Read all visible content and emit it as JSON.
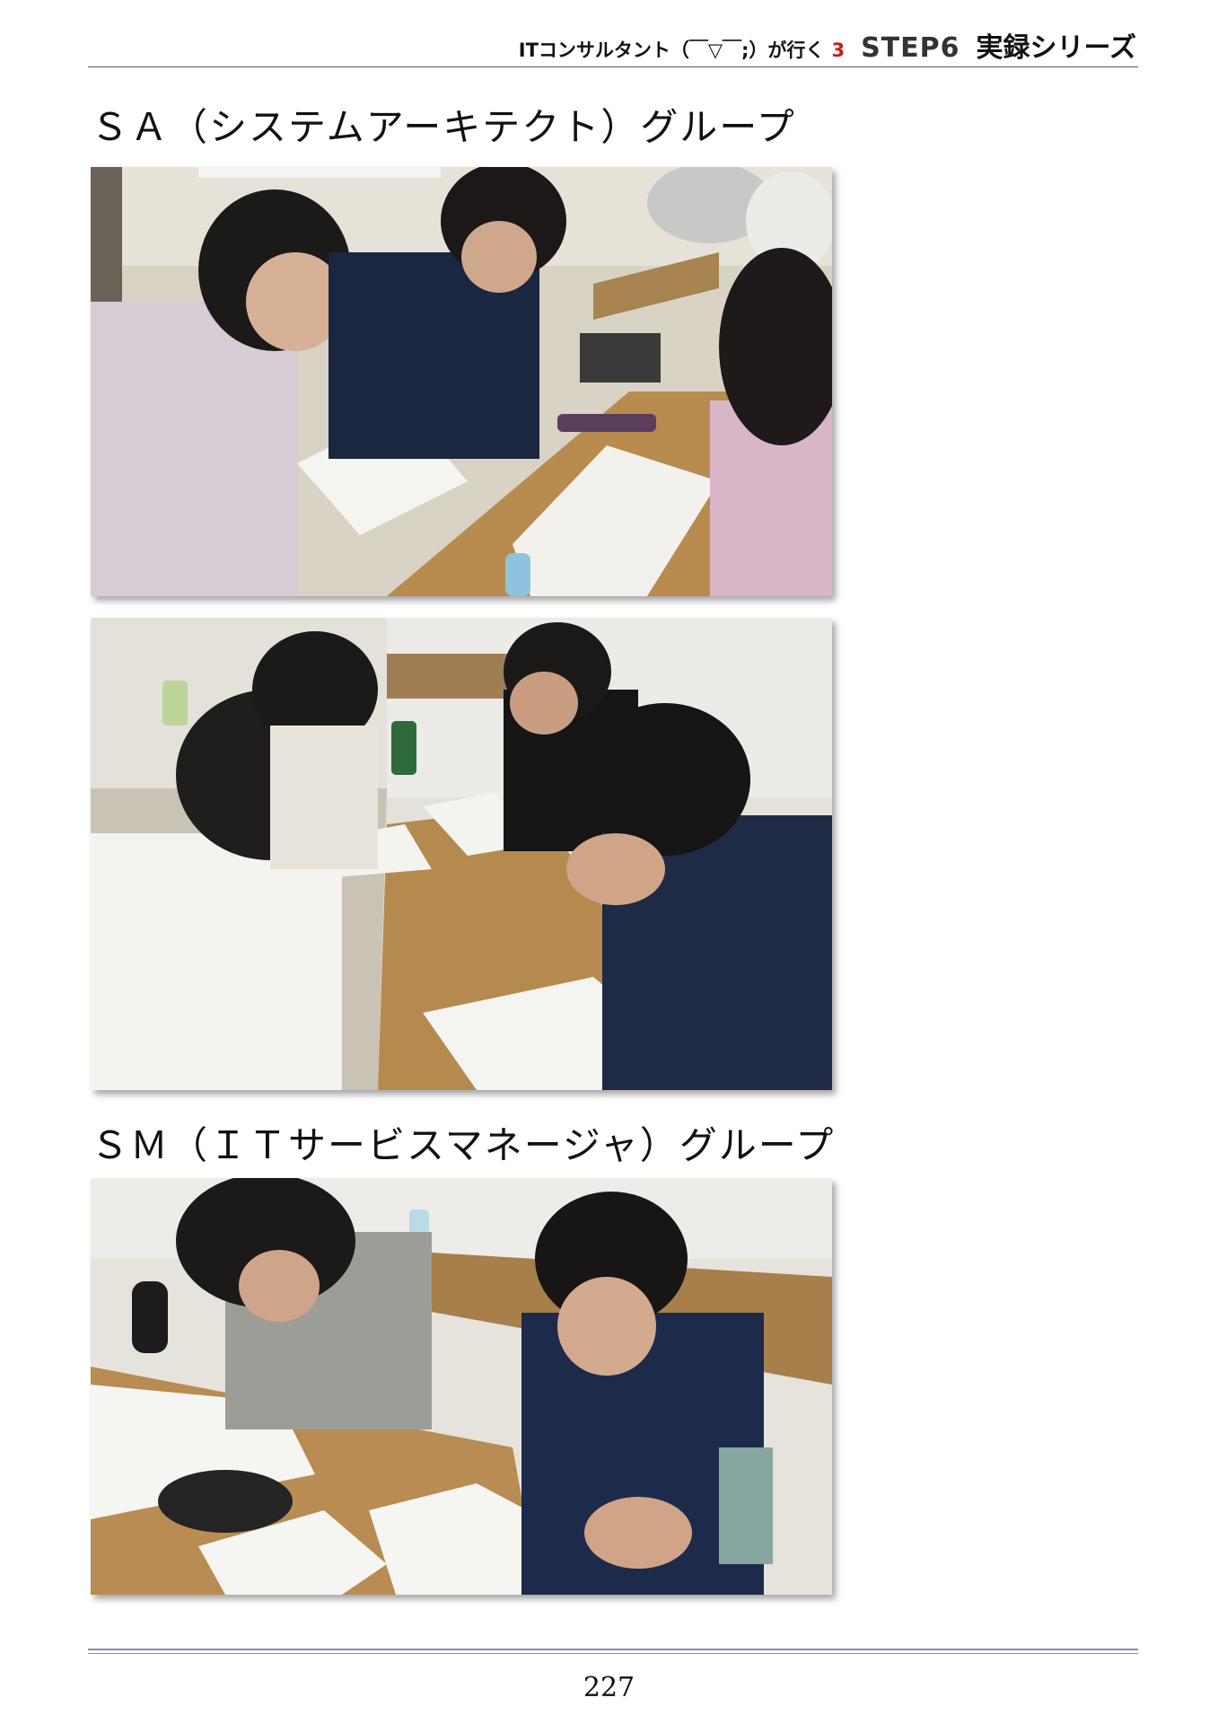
{
  "header": {
    "prefix": "ITコンサルタント（￣▽￣;）が行く",
    "volume": "3",
    "step": "STEP6",
    "series": "実録シリーズ"
  },
  "sections": [
    {
      "title": "ＳＡ（システムアーキテクト）グループ"
    },
    {
      "title": "ＳＭ（ＩＴサービスマネージャ）グループ"
    }
  ],
  "footer": {
    "page_number": "227"
  },
  "colors": {
    "footer_rule": "#8f88b8",
    "volume_accent": "#d01818"
  }
}
